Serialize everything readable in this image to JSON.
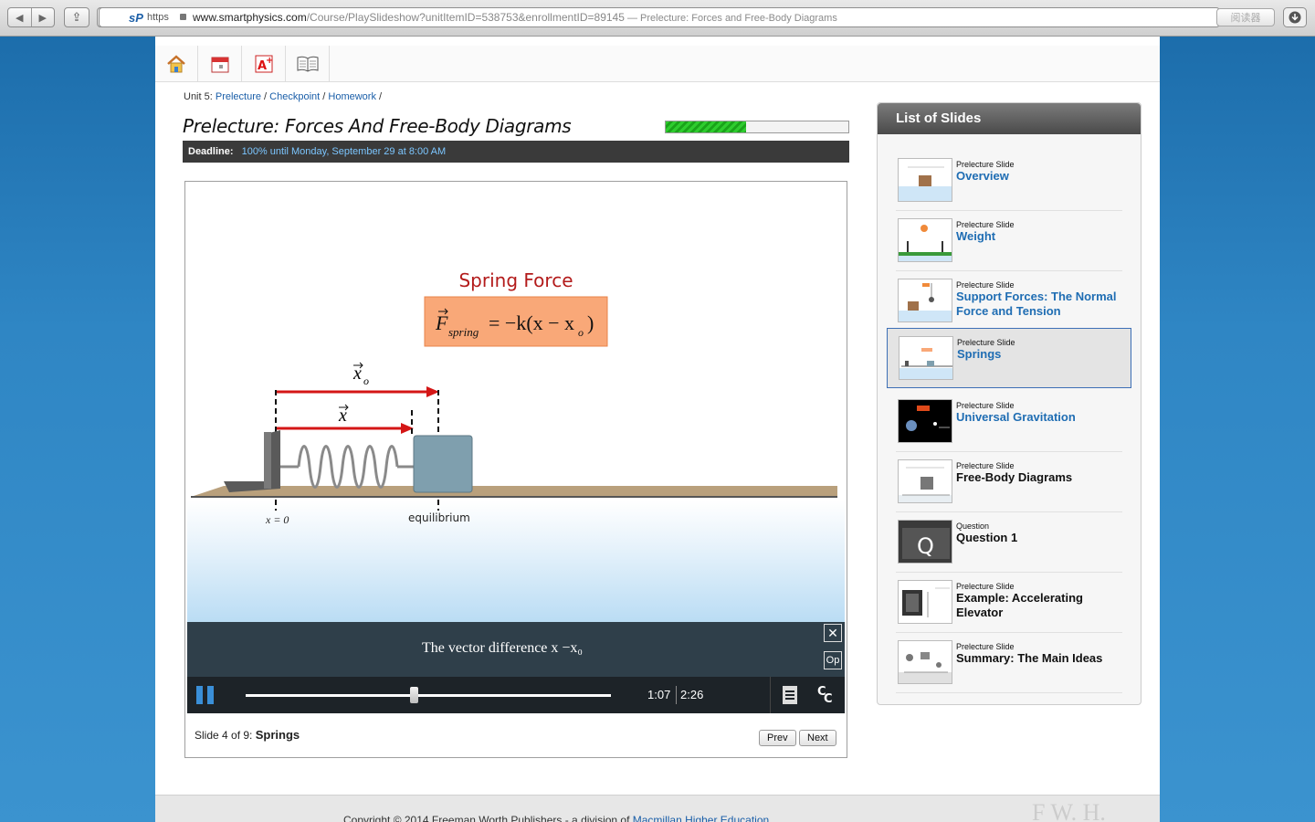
{
  "browser": {
    "https_label": "https",
    "favicon_text": "sP",
    "url_host": "www.smartphysics.com",
    "url_path": "/Course/PlaySlideshow?unitItemID=538753&enrollmentID=89145",
    "page_title": " — Prelecture: Forces and Free-Body Diagrams",
    "reader_label": "阅读器"
  },
  "breadcrumb": {
    "prefix": "Unit 5:",
    "links": [
      "Prelecture",
      "Checkpoint",
      "Homework"
    ]
  },
  "lecture": {
    "title": "Prelecture: Forces And Free-Body Diagrams",
    "progress_fraction": 0.44
  },
  "deadline": {
    "label": "Deadline:",
    "value": "100% until Monday, September 29 at 8:00 AM"
  },
  "slide": {
    "heading": "Spring Force",
    "formula_F": "F",
    "formula_sub": "spring",
    "formula_rest": "= −k(x − x",
    "formula_o": "o",
    "formula_close": ")",
    "vec_x0": "x",
    "vec_x0_sub": "o",
    "vec_x": "x",
    "label_x0": "x = 0",
    "label_equilibrium": "equilibrium"
  },
  "player": {
    "caption": "The vector difference x −x₀",
    "close_label": "✕",
    "op_label": "Op",
    "time_current": "1:07",
    "time_total": "2:26",
    "seek_fraction": 0.46,
    "cc_label": "CC",
    "footer_prefix": "Slide 4 of 9: ",
    "footer_name": "Springs",
    "prev_label": "Prev",
    "next_label": "Next"
  },
  "sidebar": {
    "header": "List of Slides",
    "items": [
      {
        "type": "Prelecture Slide",
        "name": "Overview",
        "active": false
      },
      {
        "type": "Prelecture Slide",
        "name": "Weight",
        "active": false
      },
      {
        "type": "Prelecture Slide",
        "name": "Support Forces: The Normal Force and Tension",
        "active": false
      },
      {
        "type": "Prelecture Slide",
        "name": "Springs",
        "active": true
      },
      {
        "type": "Prelecture Slide",
        "name": "Universal Gravitation",
        "active": false
      },
      {
        "type": "Prelecture Slide",
        "name": "Free-Body Diagrams",
        "active": false
      },
      {
        "type": "Question",
        "name": "Question 1",
        "active": false
      },
      {
        "type": "Prelecture Slide",
        "name": "Example: Accelerating Elevator",
        "active": false
      },
      {
        "type": "Prelecture Slide",
        "name": "Summary: The Main Ideas",
        "active": false
      }
    ]
  },
  "footer": {
    "text": "Copyright © 2014 Freeman Worth Publishers - a division of ",
    "link": "Macmillan Higher Education",
    "period": ".",
    "logo": "F W. H."
  },
  "colors": {
    "link": "#1a5ea8",
    "progress_green": "#2fcc2f",
    "formula_box": "#f9a878",
    "heading_red": "#b31b1b",
    "arrow_red": "#d41616"
  },
  "icons": [
    "home-icon",
    "calendar-icon",
    "grades-icon",
    "book-icon",
    "pause-icon",
    "notes-icon",
    "closed-captions-icon"
  ]
}
